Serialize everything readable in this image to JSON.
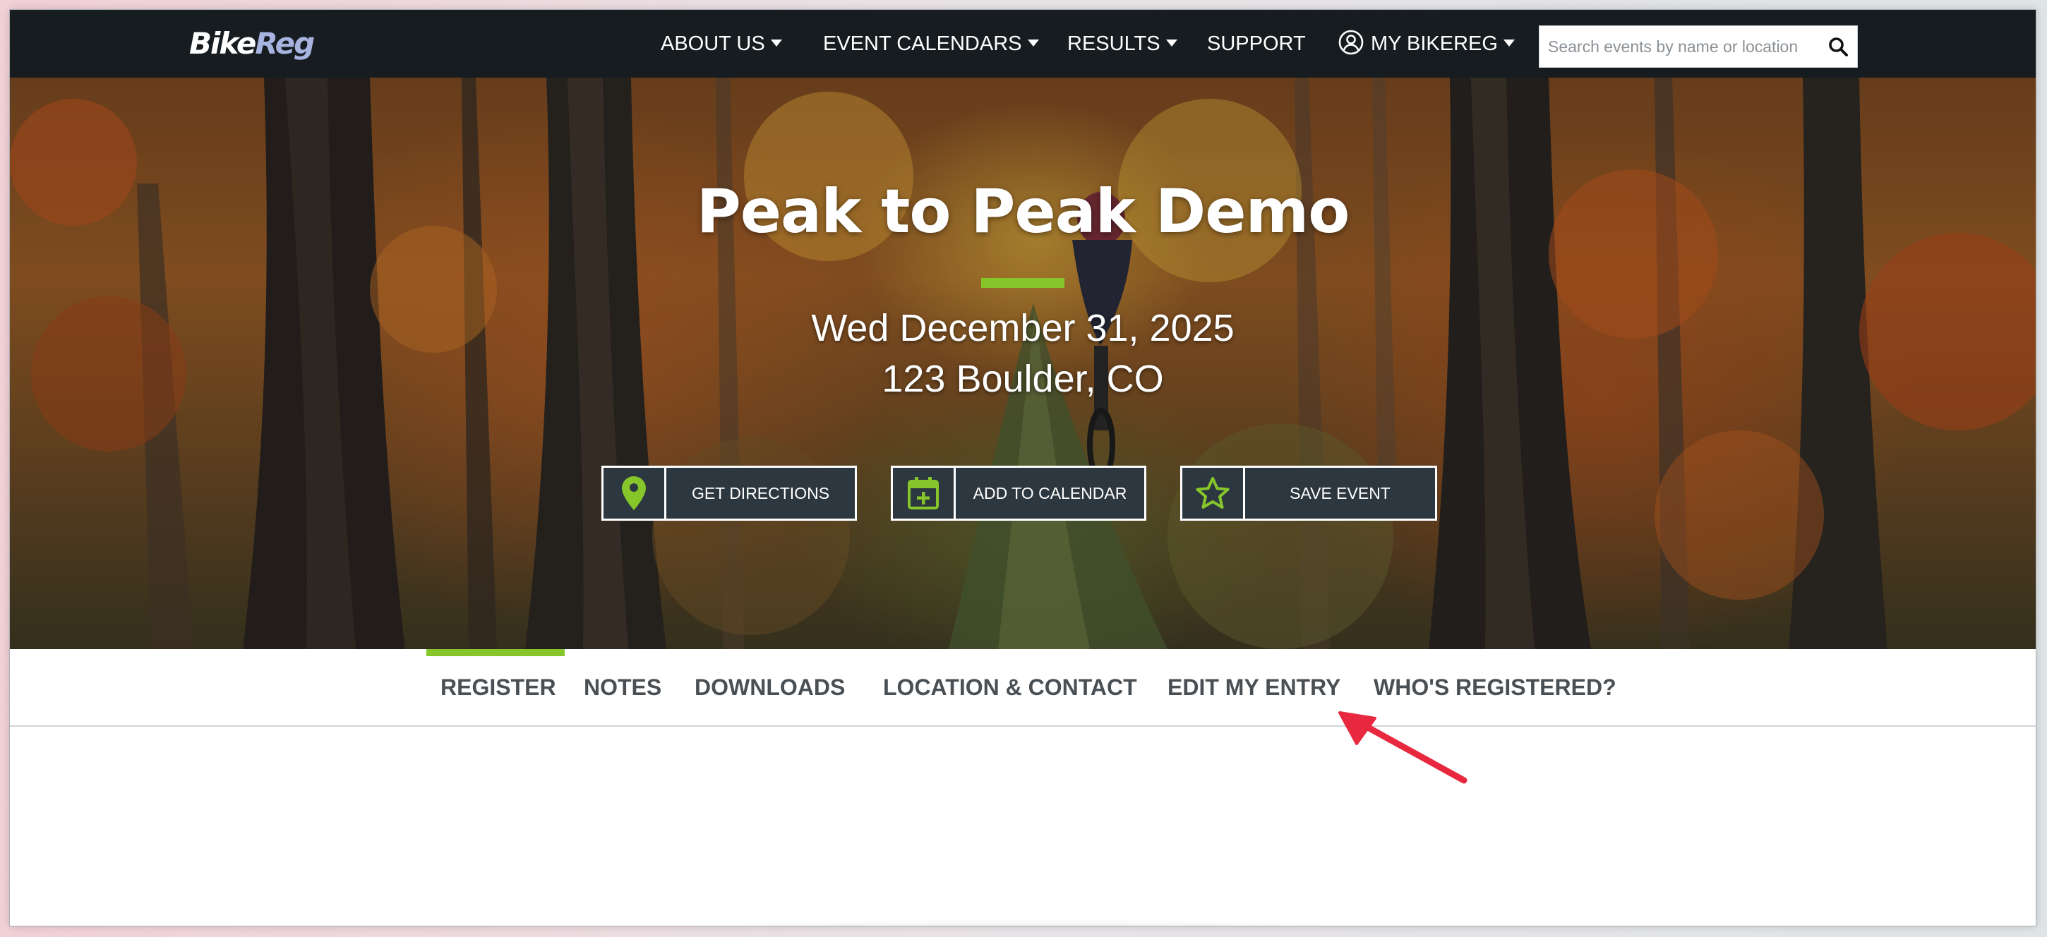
{
  "brand": {
    "logo_part1": "Bike",
    "logo_part2": "Reg",
    "accent_green": "#86c62b",
    "nav_bg": "#161c20",
    "button_bg": "#2c373f"
  },
  "nav": {
    "about": "ABOUT US",
    "calendars": "EVENT CALENDARS",
    "results": "RESULTS",
    "support": "SUPPORT",
    "my_bikereg": "MY BIKEREG",
    "search_placeholder": "Search events by name or location"
  },
  "event": {
    "title": "Peak to Peak Demo",
    "date": "Wed December 31, 2025",
    "location": "123 Boulder, CO"
  },
  "actions": {
    "directions": "GET DIRECTIONS",
    "calendar": "ADD TO CALENDAR",
    "save": "SAVE EVENT"
  },
  "tabs": {
    "register": "REGISTER",
    "notes": "NOTES",
    "downloads": "DOWNLOADS",
    "location_contact": "LOCATION & CONTACT",
    "edit_entry": "EDIT MY ENTRY",
    "whos_registered": "WHO'S REGISTERED?",
    "active": "REGISTER"
  },
  "icons": {
    "directions": "map-pin-icon",
    "calendar": "calendar-plus-icon",
    "save": "star-icon",
    "search": "search-icon",
    "user": "user-circle-icon",
    "annotation": "red-arrow-icon"
  }
}
